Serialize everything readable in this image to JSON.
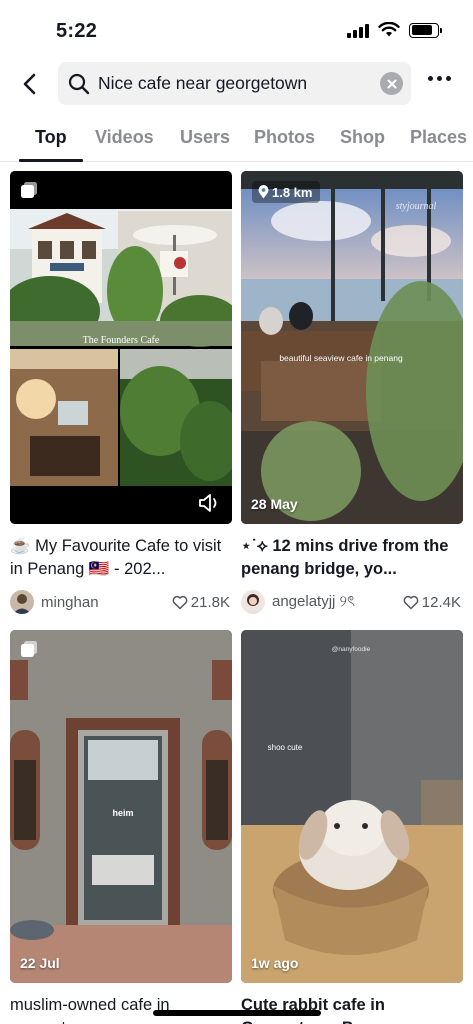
{
  "status_bar": {
    "time": "5:22"
  },
  "search": {
    "query": "Nice cafe near georgetown"
  },
  "tabs": [
    {
      "label": "Top",
      "active": true
    },
    {
      "label": "Videos"
    },
    {
      "label": "Users"
    },
    {
      "label": "Photos"
    },
    {
      "label": "Shop"
    },
    {
      "label": "Places"
    }
  ],
  "results": [
    {
      "thumb_overlay": "The Founders Cafe",
      "caption": "☕️ My Favourite Cafe to visit in Penang 🇲🇾 - 202...",
      "author": "minghan",
      "likes": "21.8K"
    },
    {
      "location": "1.8 km",
      "watermark": "styjournal",
      "thumb_overlay": "beautiful seaview cafe in penang",
      "date": "28 May",
      "caption": "⋆˙⟡ 12 mins drive from the penang bridge, yo...",
      "author": "angelatyjj ୨ৎ",
      "likes": "12.4K"
    },
    {
      "door_sign": "heim",
      "date": "22 Jul",
      "caption": "muslim-owned cafe in georgetown"
    },
    {
      "watermark": "@nanyfoodie",
      "thumb_overlay": "shoo cute",
      "date": "1w ago",
      "caption": "Cute rabbit cafe in Georgetown Penang"
    }
  ],
  "colors": {
    "text": "#161823",
    "secondary": "#8a8b91",
    "search_bg": "#f1f1f2"
  }
}
